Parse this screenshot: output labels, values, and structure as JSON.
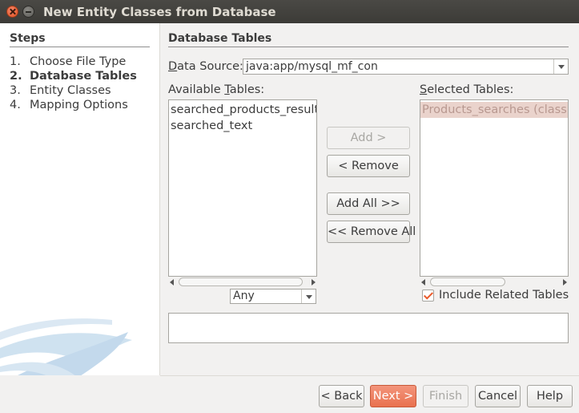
{
  "window": {
    "title": "New Entity Classes from Database"
  },
  "steps": {
    "title": "Steps",
    "items": [
      {
        "num": "1.",
        "label": "Choose File Type",
        "active": false
      },
      {
        "num": "2.",
        "label": "Database Tables",
        "active": true
      },
      {
        "num": "3.",
        "label": "Entity Classes",
        "active": false
      },
      {
        "num": "4.",
        "label": "Mapping Options",
        "active": false
      }
    ]
  },
  "main": {
    "section_title": "Database Tables",
    "data_source_label_prefix": "D",
    "data_source_label_rest": "ata Source:",
    "data_source_value": "java:app/mysql_mf_con",
    "available_label_prefix": "Available ",
    "available_label_u": "T",
    "available_label_rest": "ables:",
    "available_tables": [
      "searched_products_result",
      "searched_text"
    ],
    "filter_value": "Any",
    "selected_label_prefix": "S",
    "selected_label_rest": "elected Tables:",
    "selected_tables": [
      "Products_searches (class"
    ],
    "include_related_label": "Include Related Tables",
    "include_related_checked": true
  },
  "buttons": {
    "add": "Add >",
    "remove": "< Remove",
    "add_all": "Add All >>",
    "remove_all": "<< Remove All",
    "back": "< Back",
    "next": "Next >",
    "finish": "Finish",
    "cancel": "Cancel",
    "help": "Help"
  },
  "colors": {
    "accent": "#e9714e",
    "selected_row": "#ead3cc"
  }
}
